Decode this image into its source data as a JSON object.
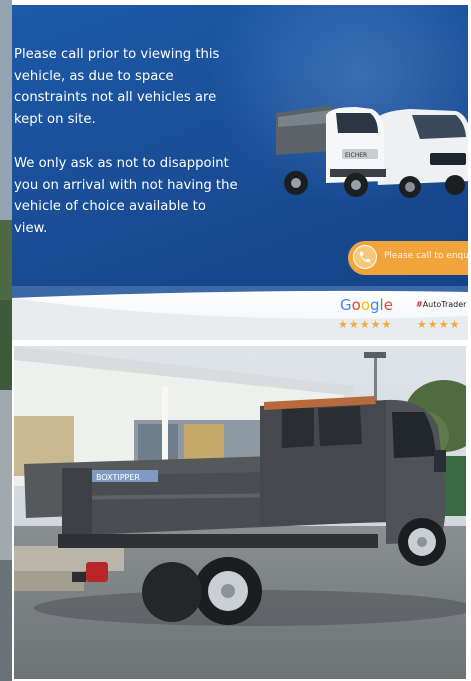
{
  "banner": {
    "paragraph_1": "Please call prior to viewing this vehicle, as due to space constraints not all vehicles are kept on site.",
    "paragraph_2": "We only ask as not to disappoint you on arrival with not having the vehicle of choice available to view.",
    "cta_label": "Please call to enquire",
    "truck_brand": "EICHER"
  },
  "reviews": {
    "google_label": "Google",
    "google_stars": "★★★★★",
    "autotrader_label": "AutoTrader",
    "autotrader_stars": "★★★★"
  },
  "photo": {
    "tailgate_label": "BOXTIPPER"
  },
  "colors": {
    "banner_blue": "#1b56a3",
    "cta_orange": "#f0a43a",
    "star_gold": "#f2a93b",
    "truck_grey": "#4a4d50"
  },
  "icons": [
    "phone-icon",
    "star-icon"
  ]
}
